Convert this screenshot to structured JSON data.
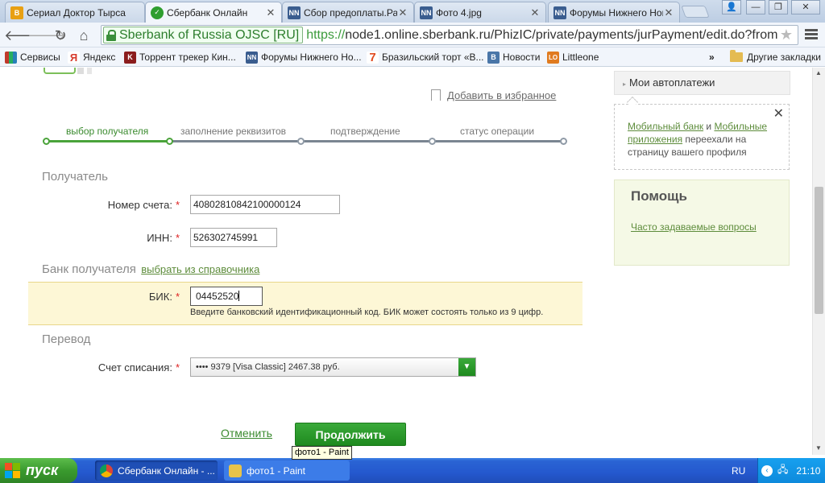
{
  "tabs": [
    {
      "title": "Сериал Доктор Тырса",
      "favicon": "B",
      "favicon_color": "#e8a013",
      "active": false
    },
    {
      "title": "Сбербанк Онлайн",
      "favicon": "sber",
      "favicon_color": "#2f9e2f",
      "active": true
    },
    {
      "title": "Сбор предоплаты.Рас",
      "favicon": "NN",
      "favicon_color": "#3a5d8f",
      "active": false
    },
    {
      "title": "Фото 4.jpg",
      "favicon": "NN",
      "favicon_color": "#3a5d8f",
      "active": false
    },
    {
      "title": "Форумы Нижнего Нов",
      "favicon": "NN",
      "favicon_color": "#3a5d8f",
      "active": false
    }
  ],
  "toolbar": {
    "ev_label": "Sberbank of Russia OJSC [RU]",
    "url_scheme": "https://",
    "url_rest": "node1.online.sberbank.ru/PhizIC/private/payments/jurPayment/edit.do?from"
  },
  "bookmarks": [
    {
      "label": "Сервисы",
      "icon": "apps-icon",
      "color": "#c0392b"
    },
    {
      "label": "Яндекс",
      "icon": "Я",
      "color": "#d63a2c"
    },
    {
      "label": "Торрент трекер Кин...",
      "icon": "K",
      "color": "#8b1d1d"
    },
    {
      "label": "Форумы Нижнего Но...",
      "icon": "NN",
      "color": "#3a5d8f"
    },
    {
      "label": "Бразильский торт «В...",
      "icon": "7",
      "color": "#e04a1f"
    },
    {
      "label": "Новости",
      "icon": "B",
      "color": "#4a76a8"
    },
    {
      "label": "Littleone",
      "icon": "LO",
      "color": "#e07b1f"
    }
  ],
  "bookmarks_more": "»",
  "other_bookmarks": "Другие закладки",
  "page": {
    "add_favorite": "Добавить в избранное",
    "steps": [
      "выбор получателя",
      "заполнение реквизитов",
      "подтверждение",
      "статус операции"
    ],
    "recipient_title": "Получатель",
    "account_label": "Номер счета:",
    "account_value": "40802810842100000124",
    "inn_label": "ИНН:",
    "inn_value": "526302745991",
    "bank_title": "Банк получателя",
    "choose_from_directory": "выбрать из справочника",
    "bik_label": "БИК:",
    "bik_value": "04452520",
    "bik_hint": "Введите банковский идентификационный код. БИК может состоять только из 9 цифр.",
    "transfer_title": "Перевод",
    "debit_label": "Счет списания:",
    "debit_value": "•••• 9379  [Visa Classic]  2467.38 руб.",
    "required_mark": "*",
    "cancel": "Отменить",
    "continue": "Продолжить"
  },
  "sidebar": {
    "autopay": "Мои автоплатежи",
    "notice_link1": "Мобильный банк",
    "notice_and": " и ",
    "notice_link2": "Мобильные приложения",
    "notice_rest": " переехали на страницу вашего профиля",
    "help_title": "Помощь",
    "help_faq": "Часто задаваемые вопросы"
  },
  "tooltip": "фото1 - Paint",
  "taskbar": {
    "start": "пуск",
    "tasks": [
      {
        "label": "Сбербанк Онлайн - ...",
        "icon": "chrome-icon"
      },
      {
        "label": "фото1 - Paint",
        "icon": "paint-icon"
      }
    ],
    "lang": "RU",
    "clock": "21:10"
  },
  "colors": {
    "accent_green": "#2f9e2f",
    "active_step": "#3b8b2f",
    "highlight_row": "#fdf7d6",
    "required": "#dd2222"
  }
}
